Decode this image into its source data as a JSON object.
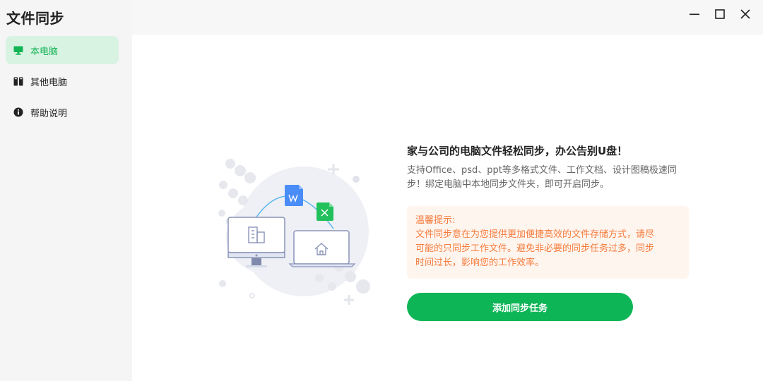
{
  "app": {
    "title": "文件同步"
  },
  "sidebar": {
    "items": [
      {
        "label": "本电脑",
        "icon": "monitor-icon",
        "active": true
      },
      {
        "label": "其他电脑",
        "icon": "computers-icon",
        "active": false
      },
      {
        "label": "帮助说明",
        "icon": "info-icon",
        "active": false
      }
    ]
  },
  "window_controls": [
    "minimize-icon",
    "maximize-icon",
    "close-icon"
  ],
  "main": {
    "headline": "家与公司的电脑文件轻松同步，办公告别U盘！",
    "description": "支持Office、psd、ppt等多格式文件、工作文档、设计图稿极速同步！绑定电脑中本地同步文件夹，即可开启同步。",
    "tip": {
      "title": "温馨提示:",
      "line1": "文件同步意在为您提供更加便捷高效的文件存储方式，请尽",
      "line2": "可能的只同步工作文件。避免非必要的同步任务过多，同步",
      "line3": "时间过长，影响您的工作效率。"
    },
    "add_button": "添加同步任务"
  },
  "colors": {
    "accent": "#0db556",
    "active_bg": "#d9f3e3",
    "tip_text": "#f47c3c",
    "tip_bg": "#fff5ef",
    "word_icon": "#4a8df8",
    "excel_icon": "#21c05c"
  }
}
